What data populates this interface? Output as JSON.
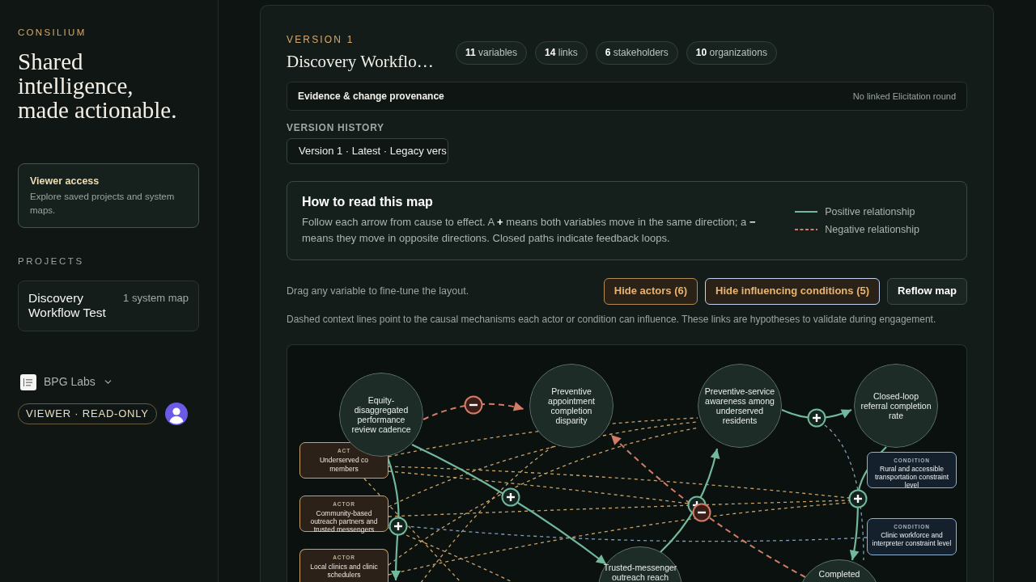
{
  "sidebar": {
    "brand": "CONSILIUM",
    "headline": "Shared intelligence, made actionable.",
    "access_card": {
      "title": "Viewer access",
      "text": "Explore saved projects and system maps."
    },
    "projects_heading": "PROJECTS",
    "projects": [
      {
        "name": "Discovery Workflow Test",
        "meta": "1 system map"
      }
    ],
    "organization": "BPG Labs",
    "role_badge": "VIEWER · READ-ONLY"
  },
  "header": {
    "version_label": "VERSION 1",
    "title": "Discovery Workflo…",
    "stats": [
      "**11** variables",
      "**14** links",
      "**6** stakeholders",
      "**10** organizations"
    ]
  },
  "provenance": {
    "title": "Evidence & change provenance",
    "status": "No linked Elicitation round"
  },
  "version_history": {
    "label": "VERSION HISTORY",
    "value": "Version 1 · Latest · Legacy vers"
  },
  "guide": {
    "title": "How to read this map",
    "text": "Follow each arrow from cause to effect. A **+** means both variables move in the same direction; a **−** means they move in opposite directions. Closed paths indicate feedback loops.",
    "legend": [
      {
        "kind": "positive",
        "label": "Positive relationship"
      },
      {
        "kind": "negative",
        "label": "Negative relationship"
      }
    ]
  },
  "controls": {
    "hint": "Drag any variable to fine-tune the layout.",
    "buttons": [
      {
        "label": "Hide actors (6)",
        "kind": "toggle",
        "focused": false
      },
      {
        "label": "Hide influencing conditions (5)",
        "kind": "toggle",
        "focused": true
      },
      {
        "label": "Reflow map",
        "kind": "action",
        "focused": false
      }
    ],
    "note": "Dashed context lines point to the causal mechanisms each actor or condition can influence. These links are hypotheses to validate during engagement."
  },
  "map": {
    "variables": [
      {
        "label": "Equity-disaggregated performance review cadence"
      },
      {
        "label": "Preventive appointment completion disparity"
      },
      {
        "label": "Preventive-service awareness among underserved residents"
      },
      {
        "label": "Closed-loop referral completion rate"
      },
      {
        "label": "Trusted-messenger outreach reach"
      },
      {
        "label": "Completed"
      }
    ],
    "actors": [
      {
        "tag": "ACT",
        "name_parts": [
          "Underserved co",
          "members"
        ]
      },
      {
        "tag": "ACTOR",
        "name_parts": [
          "Community-based outreach partners and trusted messengers"
        ]
      },
      {
        "tag": "ACTOR",
        "name_parts": [
          "Local clinics and clinic schedulers"
        ]
      }
    ],
    "conditions": [
      {
        "tag": "CONDITION",
        "name": "Rural and accessible transportation constraint level"
      },
      {
        "tag": "CONDITION",
        "name": "Clinic workforce and interpreter constraint level"
      }
    ],
    "links": [
      {
        "kind": "negative"
      },
      {
        "kind": "positive"
      },
      {
        "kind": "positive"
      },
      {
        "kind": "positive"
      },
      {
        "kind": "negative"
      },
      {
        "kind": "positive"
      },
      {
        "kind": "positive"
      }
    ],
    "context_links": [
      {
        "kind": "actor"
      },
      {
        "kind": "actor"
      },
      {
        "kind": "actor"
      },
      {
        "kind": "actor"
      },
      {
        "kind": "actor"
      },
      {
        "kind": "actor"
      },
      {
        "kind": "actor"
      },
      {
        "kind": "actor"
      },
      {
        "kind": "actor"
      },
      {
        "kind": "actor"
      },
      {
        "kind": "condition"
      },
      {
        "kind": "condition"
      }
    ]
  }
}
